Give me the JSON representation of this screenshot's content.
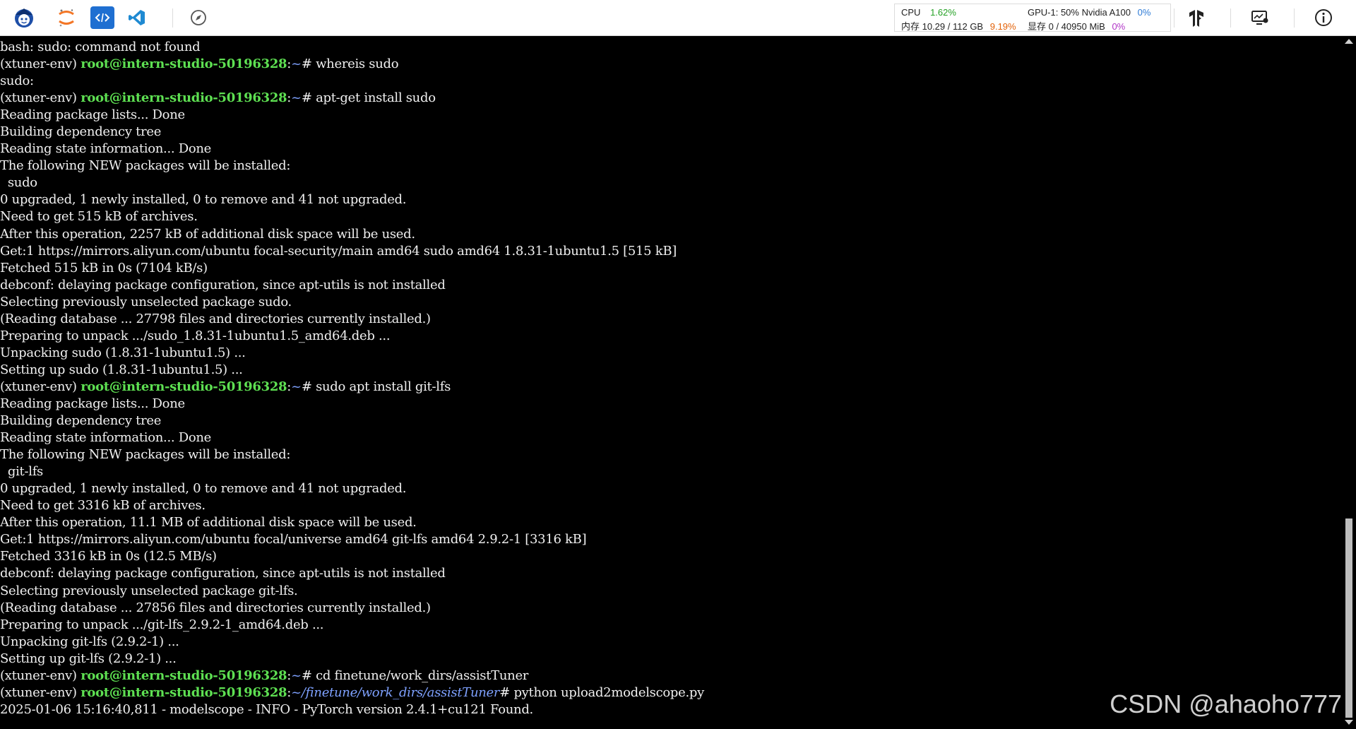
{
  "topbar": {
    "icons": [
      "intern-studio-logo-icon",
      "jupyter-icon",
      "code-editor-icon",
      "vscode-icon",
      "compass-icon",
      "tensorflow-icon",
      "monitor-icon",
      "info-icon"
    ],
    "stats": {
      "cpu_label": "CPU",
      "cpu_value": "1.62%",
      "mem_label": "内存 10.29 / 112 GB",
      "mem_value": "9.19%",
      "gpu_label": "GPU-1: 50% Nvidia A100",
      "gpu_value": "0%",
      "vram_label": "显存 0 / 40950 MiB",
      "vram_value": "0%"
    },
    "colors": {
      "cpu": "#25a125",
      "mem": "#e36209",
      "gpu": "#2e7bd6",
      "vram": "#b135c7"
    }
  },
  "prompt": {
    "env": "(xtuner-env) ",
    "user_host": "root@intern-studio-50196328",
    "colon": ":",
    "home": "~",
    "work_path": "~/finetune/work_dirs/assistTuner",
    "symbol": "# "
  },
  "terminal": {
    "lines": [
      {
        "text": "bash: sudo: command not found"
      },
      {
        "prompt": "home",
        "cmd": "whereis sudo"
      },
      {
        "text": "sudo:"
      },
      {
        "prompt": "home",
        "cmd": "apt-get install sudo"
      },
      {
        "text": "Reading package lists... Done"
      },
      {
        "text": "Building dependency tree"
      },
      {
        "text": "Reading state information... Done"
      },
      {
        "text": "The following NEW packages will be installed:"
      },
      {
        "text": "  sudo"
      },
      {
        "text": "0 upgraded, 1 newly installed, 0 to remove and 41 not upgraded."
      },
      {
        "text": "Need to get 515 kB of archives."
      },
      {
        "text": "After this operation, 2257 kB of additional disk space will be used."
      },
      {
        "text": "Get:1 https://mirrors.aliyun.com/ubuntu focal-security/main amd64 sudo amd64 1.8.31-1ubuntu1.5 [515 kB]"
      },
      {
        "text": "Fetched 515 kB in 0s (7104 kB/s)"
      },
      {
        "text": "debconf: delaying package configuration, since apt-utils is not installed"
      },
      {
        "text": "Selecting previously unselected package sudo."
      },
      {
        "text": "(Reading database ... 27798 files and directories currently installed.)"
      },
      {
        "text": "Preparing to unpack .../sudo_1.8.31-1ubuntu1.5_amd64.deb ..."
      },
      {
        "text": "Unpacking sudo (1.8.31-1ubuntu1.5) ..."
      },
      {
        "text": "Setting up sudo (1.8.31-1ubuntu1.5) ..."
      },
      {
        "prompt": "home",
        "cmd": "sudo apt install git-lfs"
      },
      {
        "text": "Reading package lists... Done"
      },
      {
        "text": "Building dependency tree"
      },
      {
        "text": "Reading state information... Done"
      },
      {
        "text": "The following NEW packages will be installed:"
      },
      {
        "text": "  git-lfs"
      },
      {
        "text": "0 upgraded, 1 newly installed, 0 to remove and 41 not upgraded."
      },
      {
        "text": "Need to get 3316 kB of archives."
      },
      {
        "text": "After this operation, 11.1 MB of additional disk space will be used."
      },
      {
        "text": "Get:1 https://mirrors.aliyun.com/ubuntu focal/universe amd64 git-lfs amd64 2.9.2-1 [3316 kB]"
      },
      {
        "text": "Fetched 3316 kB in 0s (12.5 MB/s)"
      },
      {
        "text": "debconf: delaying package configuration, since apt-utils is not installed"
      },
      {
        "text": "Selecting previously unselected package git-lfs."
      },
      {
        "text": "(Reading database ... 27856 files and directories currently installed.)"
      },
      {
        "text": "Preparing to unpack .../git-lfs_2.9.2-1_amd64.deb ..."
      },
      {
        "text": "Unpacking git-lfs (2.9.2-1) ..."
      },
      {
        "text": "Setting up git-lfs (2.9.2-1) ..."
      },
      {
        "prompt": "home",
        "cmd": "cd finetune/work_dirs/assistTuner"
      },
      {
        "prompt": "work_path",
        "cmd": "python upload2modelscope.py"
      },
      {
        "text": "2025-01-06 15:16:40,811 - modelscope - INFO - PyTorch version 2.4.1+cu121 Found."
      }
    ]
  },
  "watermark": "CSDN @ahaoho777"
}
